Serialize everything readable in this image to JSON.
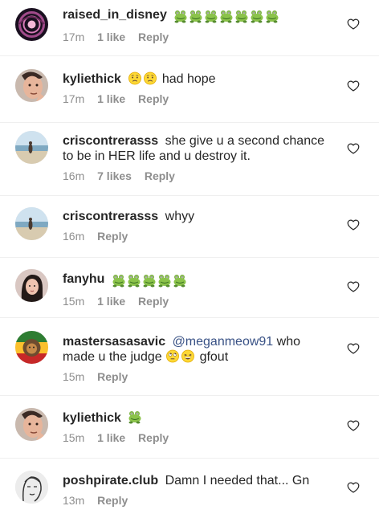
{
  "comments": [
    {
      "username": "raised_in_disney",
      "text": "",
      "emojis": [
        "frog",
        "frog",
        "frog",
        "frog",
        "frog",
        "frog",
        "frog"
      ],
      "time": "17m",
      "likes": "1 like",
      "reply": "Reply",
      "avatar": "dark-swirl"
    },
    {
      "username": "kyliethick",
      "text": "had hope",
      "emojis_before": [
        "worried-face",
        "worried-face"
      ],
      "time": "17m",
      "likes": "1 like",
      "reply": "Reply",
      "avatar": "face-photo"
    },
    {
      "username": "criscontrerasss",
      "text": "she give u a second chance to be in HER life and u destroy it.",
      "time": "16m",
      "likes": "7 likes",
      "reply": "Reply",
      "avatar": "beach-photo"
    },
    {
      "username": "criscontrerasss",
      "text": "whyy",
      "time": "16m",
      "likes": "",
      "reply": "Reply",
      "avatar": "beach-photo"
    },
    {
      "username": "fanyhu",
      "text": "",
      "emojis": [
        "frog",
        "frog",
        "frog",
        "frog",
        "frog"
      ],
      "time": "15m",
      "likes": "1 like",
      "reply": "Reply",
      "avatar": "girl-photo"
    },
    {
      "username": "mastersasasavic",
      "mention": "@meganmeow91",
      "text_a": "who made u the judge",
      "emojis_mid": [
        "rolling-eyes",
        "grin-squint"
      ],
      "text_b": "gfout",
      "time": "15m",
      "likes": "",
      "reply": "Reply",
      "avatar": "lion-rasta"
    },
    {
      "username": "kyliethick",
      "text": "",
      "emojis": [
        "frog"
      ],
      "time": "15m",
      "likes": "1 like",
      "reply": "Reply",
      "avatar": "face-photo"
    },
    {
      "username": "poshpirate.club",
      "text": "Damn I needed that... Gn",
      "time": "13m",
      "likes": "",
      "reply": "Reply",
      "avatar": "sketch-face"
    }
  ],
  "colors": {
    "username": "#262626",
    "meta": "#8e8e8e",
    "mention": "#385185",
    "divider": "#efefef"
  }
}
